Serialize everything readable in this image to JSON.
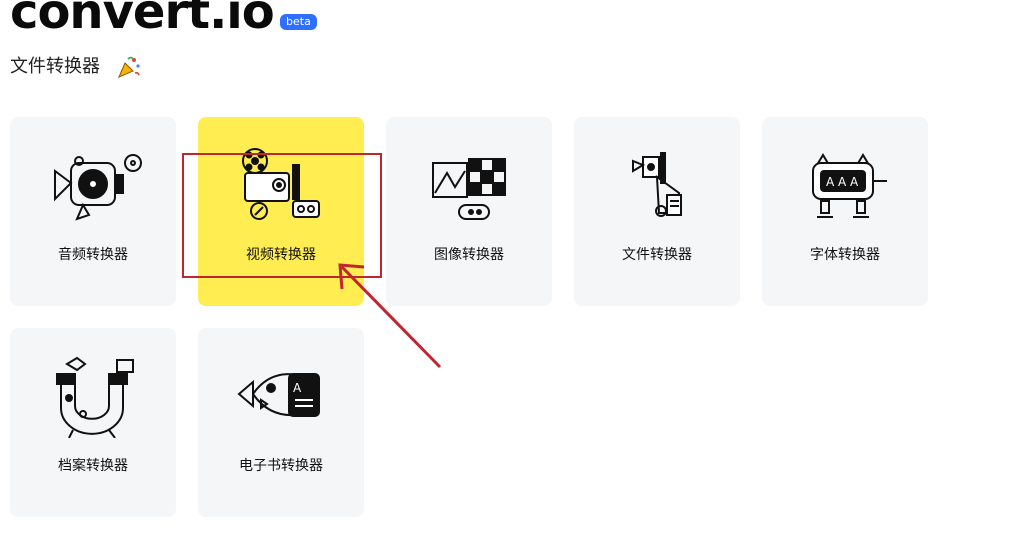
{
  "header": {
    "logo_text": "convert.io",
    "beta_badge": "beta",
    "subtitle": "文件转换器"
  },
  "colors": {
    "card_bg": "#f5f6f8",
    "active_card_bg": "#ffed52",
    "beta_bg": "#2f6fff",
    "annotation_red": "#c0262d"
  },
  "converters": [
    {
      "label": "音频转换器",
      "icon": "audio-camera-fish-icon",
      "active": false
    },
    {
      "label": "视频转换器",
      "icon": "video-projector-icon",
      "active": true
    },
    {
      "label": "图像转换器",
      "icon": "image-grid-icon",
      "active": false
    },
    {
      "label": "文件转换器",
      "icon": "document-giraffe-icon",
      "active": false
    },
    {
      "label": "字体转换器",
      "icon": "font-robot-icon",
      "active": false
    },
    {
      "label": "档案转换器",
      "icon": "archive-magnet-icon",
      "active": false
    },
    {
      "label": "电子书转换器",
      "icon": "ebook-fish-icon",
      "active": false
    }
  ]
}
